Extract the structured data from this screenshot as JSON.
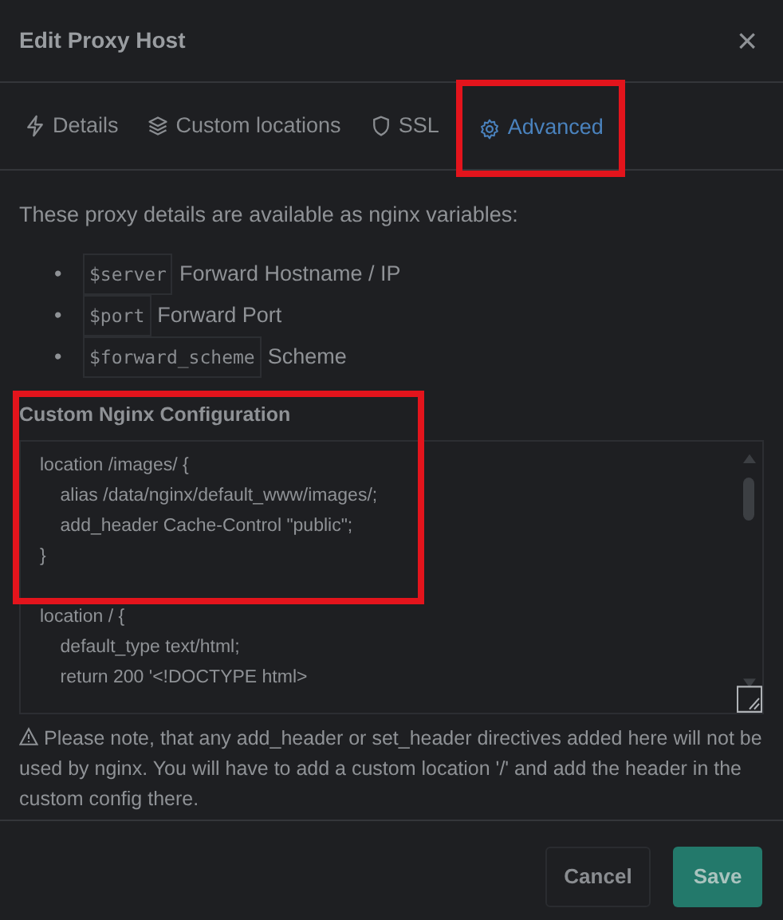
{
  "modal": {
    "title": "Edit Proxy Host",
    "close": "×"
  },
  "tabs": [
    {
      "label": "Details",
      "selected": false,
      "highlighted": false
    },
    {
      "label": "Custom locations",
      "selected": false,
      "highlighted": false
    },
    {
      "label": "SSL",
      "selected": false,
      "highlighted": false
    },
    {
      "label": "Advanced",
      "selected": true,
      "highlighted": true
    }
  ],
  "intro": "These proxy details are available as nginx variables:",
  "variables": [
    {
      "bullet": "•",
      "code": "$server",
      "description": "Forward Hostname / IP"
    },
    {
      "bullet": "•",
      "code": "$port",
      "description": "Forward Port"
    },
    {
      "bullet": "•",
      "code": "$forward_scheme",
      "description": "Scheme"
    }
  ],
  "config": {
    "label": "Custom Nginx Configuration",
    "highlighted": true,
    "blocks": [
      [
        "location /images/ {",
        "    alias /data/nginx/default_www/images/;",
        "    add_header Cache-Control \"public\";",
        "}"
      ],
      [
        "location / {",
        "    default_type text/html;",
        "    return 200 '<!DOCTYPE html>"
      ]
    ]
  },
  "note": "Please note, that any add_header or set_header directives added here will not be used by nginx. You will have to add a custom location '/' and add the header in the custom config there.",
  "buttons": [
    {
      "label": "Cancel",
      "kind": "secondary"
    },
    {
      "label": "Save",
      "kind": "primary"
    }
  ]
}
